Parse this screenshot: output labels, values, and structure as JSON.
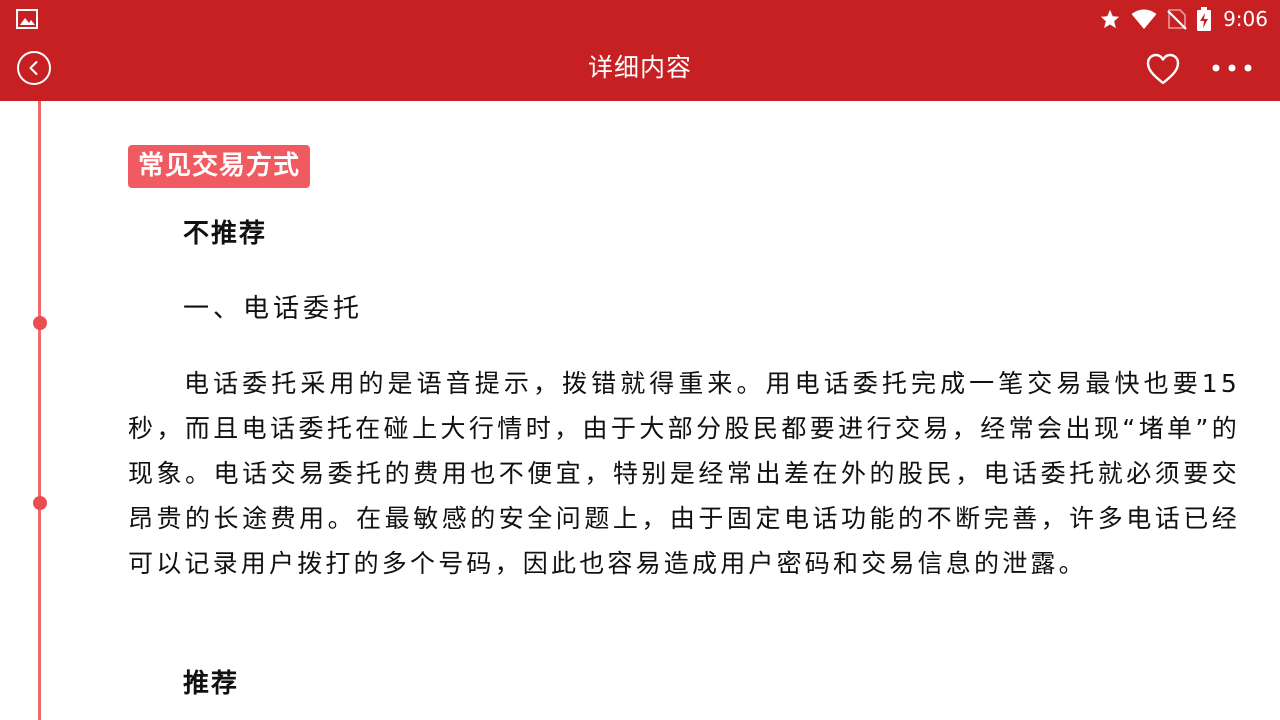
{
  "status_bar": {
    "time": "9:06",
    "icons": [
      "image-icon",
      "star-icon",
      "wifi-icon",
      "no-sim-icon",
      "battery-charging-icon"
    ]
  },
  "toolbar": {
    "title": "详细内容",
    "back_icon": "back-circle-icon",
    "favorite_icon": "heart-outline-icon",
    "more_icon": "more-dots-icon"
  },
  "colors": {
    "header": "#c62022",
    "tag": "#ef5b61",
    "timeline": "#ef6a6d",
    "text": "#111111"
  },
  "article": {
    "section_tag": "常见交易方式",
    "not_recommended": "不推荐",
    "item_heading": "一、电话委托",
    "paragraph": "电话委托采用的是语音提示，拨错就得重来。用电话委托完成一笔交易最快也要15秒，而且电话委托在碰上大行情时，由于大部分股民都要进行交易，经常会出现“堵单”的现象。电话交易委托的费用也不便宜，特别是经常出差在外的股民，电话委托就必须要交昂贵的长途费用。在最敏感的安全问题上，由于固定电话功能的不断完善，许多电话已经可以记录用户拨打的多个号码，因此也容易造成用户密码和交易信息的泄露。",
    "recommended": "推荐"
  }
}
